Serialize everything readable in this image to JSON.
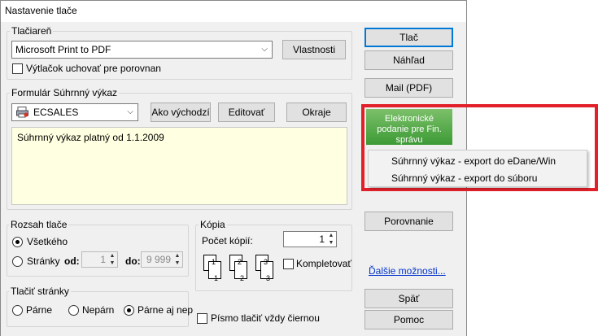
{
  "window": {
    "title": "Nastavenie tlače"
  },
  "printer": {
    "group_label": "Tlačiareň",
    "selected": "Microsoft Print to PDF",
    "properties_label": "Vlastnosti",
    "keep_copy_label": "Výtlačok uchovať pre porovnan",
    "keep_copy_checked": false
  },
  "form": {
    "group_label": "Formulár  Súhrnný výkaz",
    "selected": "ECSALES",
    "default_label": "Ako východzí",
    "edit_label": "Editovať",
    "margins_label": "Okraje",
    "description": "Súhrnný výkaz platný od 1.1.2009"
  },
  "range": {
    "group_label": "Rozsah tlače",
    "all_label": "Všetkého",
    "pages_label": "Stránky",
    "from_label": "od:",
    "from_value": "1",
    "to_label": "do:",
    "to_value": "9 999",
    "selected": "all"
  },
  "copies": {
    "group_label": "Kópia",
    "count_label": "Počet kópií:",
    "count_value": "1",
    "collate_label": "Kompletovať",
    "collate_checked": false,
    "page_numbers": [
      "1",
      "1",
      "2",
      "2",
      "3",
      "3"
    ]
  },
  "print_pages": {
    "group_label": "Tlačiť stránky",
    "even_label": "Párne",
    "odd_label": "Nepárn",
    "both_label": "Párne aj nep",
    "selected": "both"
  },
  "black_font": {
    "label": "Písmo tlačiť vždy čiernou",
    "checked": false
  },
  "side": {
    "print_label": "Tlač",
    "preview_label": "Náhľad",
    "mail_label": "Mail (PDF)",
    "epodanie_label": "Elektronické podanie pre Fin. správu",
    "menu_items": [
      "Súhrnný výkaz - export do eDane/Win",
      "Súhrnný výkaz - export do súboru"
    ],
    "compare_label": "Porovnanie",
    "more_label": "Ďalšie možnosti...",
    "back_label": "Späť",
    "help_label": "Pomoc"
  },
  "colors": {
    "highlight": "#e2202a",
    "green": "#3c9a35",
    "link": "#0033cc"
  }
}
